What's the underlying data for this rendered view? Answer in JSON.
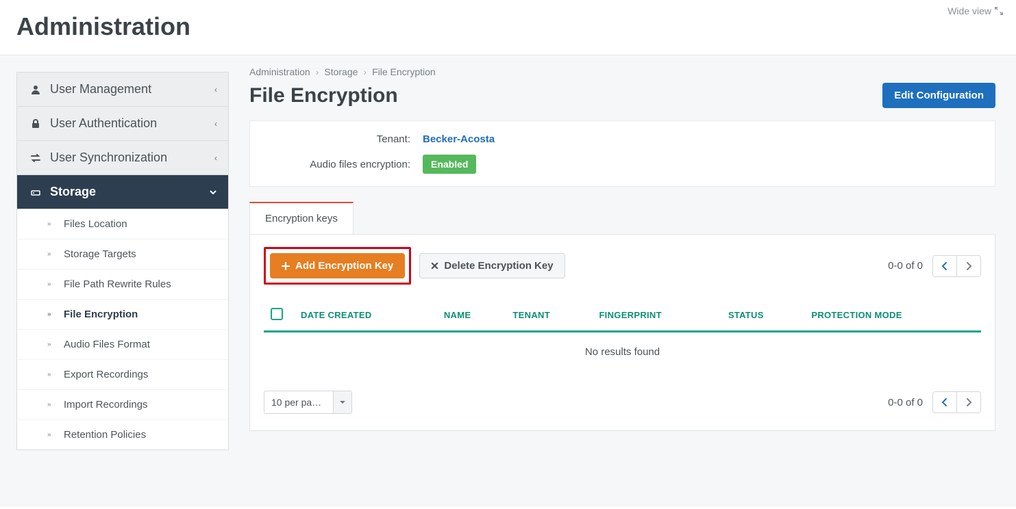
{
  "wide_view": "Wide view",
  "page_title": "Administration",
  "breadcrumb": [
    "Administration",
    "Storage",
    "File Encryption"
  ],
  "section_title": "File Encryption",
  "edit_button": "Edit Configuration",
  "sidebar": {
    "items": [
      {
        "label": "User Management",
        "icon": "user"
      },
      {
        "label": "User Authentication",
        "icon": "lock"
      },
      {
        "label": "User Synchronization",
        "icon": "sync"
      },
      {
        "label": "Storage",
        "icon": "drive",
        "active": true
      }
    ],
    "storage_sub": [
      "Files Location",
      "Storage Targets",
      "File Path Rewrite Rules",
      "File Encryption",
      "Audio Files Format",
      "Export Recordings",
      "Import Recordings",
      "Retention Policies"
    ],
    "current_sub": "File Encryption"
  },
  "info": {
    "tenant_label": "Tenant:",
    "tenant_value": "Becker-Acosta",
    "encryption_label": "Audio files encryption:",
    "encryption_badge": "Enabled"
  },
  "tabs": {
    "encryption_keys": "Encryption keys"
  },
  "toolbar": {
    "add_button": "Add Encryption Key",
    "delete_button": "Delete Encryption Key"
  },
  "table": {
    "columns": [
      "DATE CREATED",
      "NAME",
      "TENANT",
      "FINGERPRINT",
      "STATUS",
      "PROTECTION MODE"
    ],
    "empty": "No results found"
  },
  "pagination": {
    "range": "0-0 of 0",
    "per_page": "10 per pa…"
  }
}
